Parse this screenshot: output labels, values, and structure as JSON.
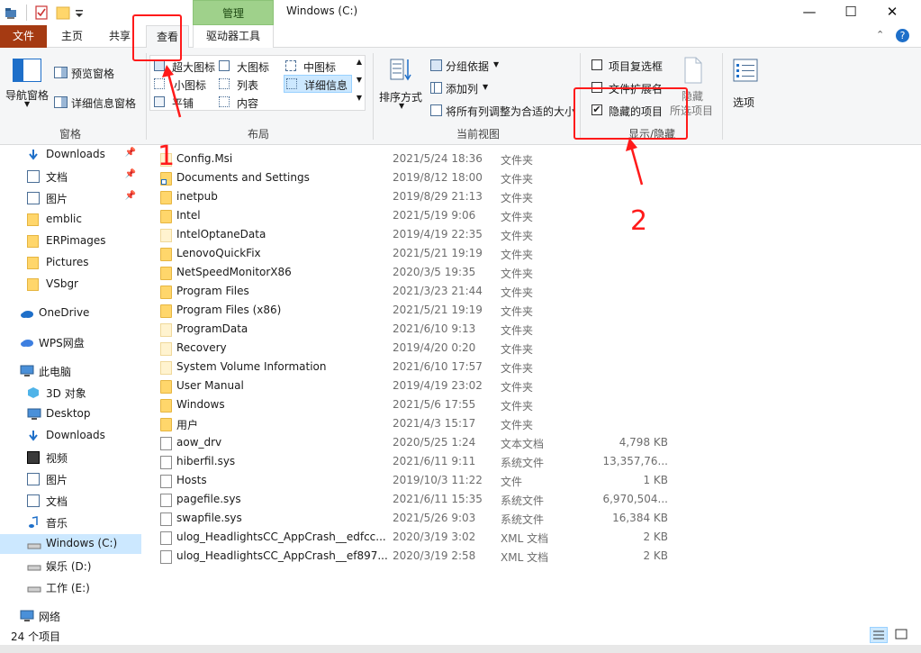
{
  "titlebar": {
    "window_title": "Windows (C:)",
    "context_tab_header": "管理",
    "minimize": "—",
    "maximize": "☐",
    "close": "✕"
  },
  "tabs": {
    "file": "文件",
    "home": "主页",
    "share": "共享",
    "view": "查看",
    "drive_tools": "驱动器工具"
  },
  "ribbon": {
    "pane_group": {
      "nav_pane": "导航窗格",
      "preview_pane": "预览窗格",
      "details_pane": "详细信息窗格",
      "title": "窗格"
    },
    "layout_group": {
      "items": [
        "超大图标",
        "大图标",
        "中图标",
        "小图标",
        "列表",
        "详细信息",
        "平铺",
        "内容"
      ],
      "title": "布局"
    },
    "current_view_group": {
      "sort_by": "排序方式",
      "group_by": "分组依据",
      "add_column": "添加列",
      "fit_columns": "将所有列调整为合适的大小",
      "title": "当前视图"
    },
    "show_hide_group": {
      "item_checkboxes": "项目复选框",
      "file_extensions": "文件扩展名",
      "hidden_items": "隐藏的项目",
      "hidden_items_checked": true,
      "hide_selected": "隐藏",
      "hide_selected_sub": "所选项目",
      "title": "显示/隐藏"
    },
    "options": "选项"
  },
  "nav": {
    "items": [
      {
        "label": "Downloads",
        "icon": "download-icon",
        "pinned": true
      },
      {
        "label": "文档",
        "icon": "documents-icon",
        "pinned": true
      },
      {
        "label": "图片",
        "icon": "pictures-icon",
        "pinned": true
      },
      {
        "label": "emblic",
        "icon": "folder-icon"
      },
      {
        "label": "ERPimages",
        "icon": "folder-icon"
      },
      {
        "label": "Pictures",
        "icon": "folder-icon"
      },
      {
        "label": "VSbgr",
        "icon": "folder-icon"
      },
      {
        "label": "OneDrive",
        "icon": "cloud-icon"
      },
      {
        "label": "WPS网盘",
        "icon": "wps-cloud-icon"
      },
      {
        "label": "此电脑",
        "icon": "computer-icon"
      },
      {
        "label": "3D 对象",
        "icon": "3d-objects-icon"
      },
      {
        "label": "Desktop",
        "icon": "desktop-icon"
      },
      {
        "label": "Downloads",
        "icon": "download-icon"
      },
      {
        "label": "视频",
        "icon": "videos-icon"
      },
      {
        "label": "图片",
        "icon": "pictures-icon"
      },
      {
        "label": "文档",
        "icon": "documents-icon"
      },
      {
        "label": "音乐",
        "icon": "music-icon"
      },
      {
        "label": "Windows (C:)",
        "icon": "drive-icon",
        "selected": true
      },
      {
        "label": "娱乐 (D:)",
        "icon": "drive-icon"
      },
      {
        "label": "工作 (E:)",
        "icon": "drive-icon"
      },
      {
        "label": "网络",
        "icon": "network-icon"
      }
    ]
  },
  "files": [
    {
      "name": "Config.Msi",
      "date": "2021/5/24 18:36",
      "type": "文件夹",
      "size": "",
      "kind": "folder-pale"
    },
    {
      "name": "Documents and Settings",
      "date": "2019/8/12 18:00",
      "type": "文件夹",
      "size": "",
      "kind": "folder-link"
    },
    {
      "name": "inetpub",
      "date": "2019/8/29 21:13",
      "type": "文件夹",
      "size": "",
      "kind": "folder"
    },
    {
      "name": "Intel",
      "date": "2021/5/19 9:06",
      "type": "文件夹",
      "size": "",
      "kind": "folder"
    },
    {
      "name": "IntelOptaneData",
      "date": "2019/4/19 22:35",
      "type": "文件夹",
      "size": "",
      "kind": "folder-pale"
    },
    {
      "name": "LenovoQuickFix",
      "date": "2021/5/21 19:19",
      "type": "文件夹",
      "size": "",
      "kind": "folder"
    },
    {
      "name": "NetSpeedMonitorX86",
      "date": "2020/3/5 19:35",
      "type": "文件夹",
      "size": "",
      "kind": "folder"
    },
    {
      "name": "Program Files",
      "date": "2021/3/23 21:44",
      "type": "文件夹",
      "size": "",
      "kind": "folder"
    },
    {
      "name": "Program Files (x86)",
      "date": "2021/5/21 19:19",
      "type": "文件夹",
      "size": "",
      "kind": "folder"
    },
    {
      "name": "ProgramData",
      "date": "2021/6/10 9:13",
      "type": "文件夹",
      "size": "",
      "kind": "folder-pale"
    },
    {
      "name": "Recovery",
      "date": "2019/4/20 0:20",
      "type": "文件夹",
      "size": "",
      "kind": "folder-pale"
    },
    {
      "name": "System Volume Information",
      "date": "2021/6/10 17:57",
      "type": "文件夹",
      "size": "",
      "kind": "folder-pale"
    },
    {
      "name": "User Manual",
      "date": "2019/4/19 23:02",
      "type": "文件夹",
      "size": "",
      "kind": "folder"
    },
    {
      "name": "Windows",
      "date": "2021/5/6 17:55",
      "type": "文件夹",
      "size": "",
      "kind": "folder"
    },
    {
      "name": "用户",
      "date": "2021/4/3 15:17",
      "type": "文件夹",
      "size": "",
      "kind": "folder"
    },
    {
      "name": "aow_drv",
      "date": "2020/5/25 1:24",
      "type": "文本文档",
      "size": "4,798 KB",
      "kind": "text"
    },
    {
      "name": "hiberfil.sys",
      "date": "2021/6/11 9:11",
      "type": "系统文件",
      "size": "13,357,76...",
      "kind": "sys"
    },
    {
      "name": "Hosts",
      "date": "2019/10/3 11:22",
      "type": "文件",
      "size": "1 KB",
      "kind": "file"
    },
    {
      "name": "pagefile.sys",
      "date": "2021/6/11 15:35",
      "type": "系统文件",
      "size": "6,970,504...",
      "kind": "sys"
    },
    {
      "name": "swapfile.sys",
      "date": "2021/5/26 9:03",
      "type": "系统文件",
      "size": "16,384 KB",
      "kind": "sys"
    },
    {
      "name": "ulog_HeadlightsCC_AppCrash__edfcc...",
      "date": "2020/3/19 3:02",
      "type": "XML 文档",
      "size": "2 KB",
      "kind": "xml"
    },
    {
      "name": "ulog_HeadlightsCC_AppCrash__ef897...",
      "date": "2020/3/19 2:58",
      "type": "XML 文档",
      "size": "2 KB",
      "kind": "xml"
    }
  ],
  "status": {
    "count": "24 个项目"
  },
  "annotations": {
    "step1": "1",
    "step2": "2",
    "color": "#ff1a1a"
  },
  "colors": {
    "file_tab": "#a53a12",
    "context_tab": "#9fd18b",
    "selection": "#cce8ff",
    "folder": "#ffd66b"
  }
}
